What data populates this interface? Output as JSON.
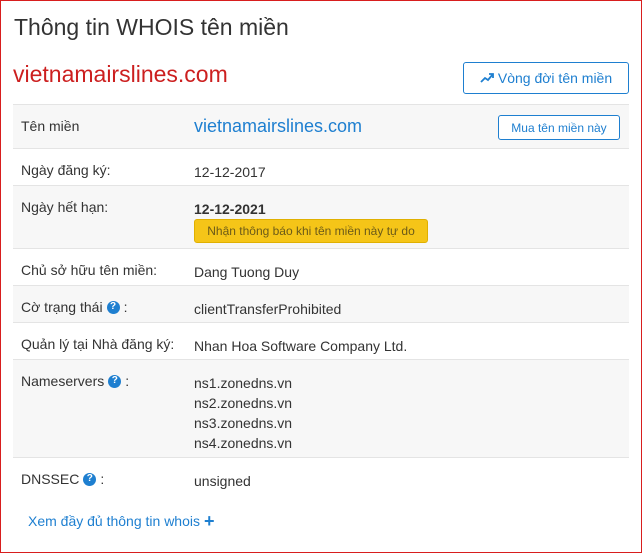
{
  "page_title": "Thông tin WHOIS tên miền",
  "domain_heading": "vietnamairslines.com",
  "lifecycle_button": {
    "label": "Vòng đời tên miền",
    "icon": "trending-up-icon"
  },
  "rows": {
    "domain": {
      "label": "Tên miền",
      "value": "vietnamairslines.com",
      "buy_label": "Mua tên miền này"
    },
    "registered": {
      "label": "Ngày đăng ký:",
      "value": "12-12-2017"
    },
    "expires": {
      "label": "Ngày hết hạn:",
      "value": "12-12-2021",
      "notify_label": "Nhận thông báo khi tên miền này tự do"
    },
    "owner": {
      "label": "Chủ sở hữu tên miền:",
      "value": "Dang Tuong Duy"
    },
    "status": {
      "label": "Cờ trạng thái",
      "suffix": ":",
      "value": "clientTransferProhibited"
    },
    "registrar": {
      "label": "Quản lý tại Nhà đăng ký:",
      "value": "Nhan Hoa Software Company Ltd."
    },
    "nameservers": {
      "label": "Nameservers",
      "suffix": ":",
      "values": [
        "ns1.zonedns.vn",
        "ns2.zonedns.vn",
        "ns3.zonedns.vn",
        "ns4.zonedns.vn"
      ]
    },
    "dnssec": {
      "label": "DNSSEC",
      "suffix": ":",
      "value": "unsigned"
    }
  },
  "help_glyph": "?",
  "more_link": {
    "label": "Xem đầy đủ thông tin whois",
    "icon_glyph": "+"
  },
  "colors": {
    "accent": "#1e7fd0",
    "brand_red": "#cc1f1f",
    "notify_yellow": "#f5c518"
  }
}
